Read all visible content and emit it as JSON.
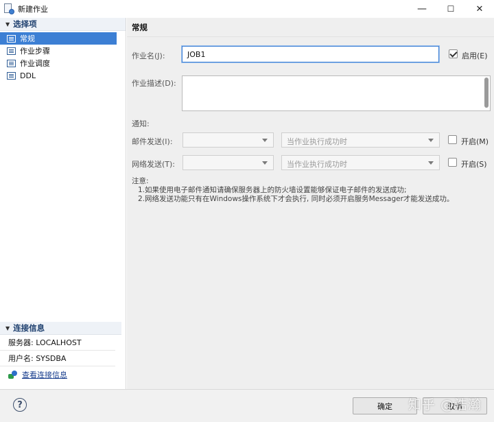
{
  "window": {
    "title": "新建作业",
    "minimize": "—",
    "maximize": "☐",
    "close": "✕"
  },
  "sidebar": {
    "section_title": "选择项",
    "items": [
      {
        "label": "常规"
      },
      {
        "label": "作业步骤"
      },
      {
        "label": "作业调度"
      },
      {
        "label": "DDL"
      }
    ],
    "selected_index": 0
  },
  "connection": {
    "section_title": "连接信息",
    "server": "服务器: LOCALHOST",
    "user": "用户名: SYSDBA",
    "view_link": "查看连接信息"
  },
  "main": {
    "header": "常规",
    "job_name_label": "作业名(J):",
    "job_name_value": "JOB1",
    "enable_label": "启用(E)",
    "enable_checked": true,
    "desc_label": "作业描述(D):",
    "desc_value": "",
    "notify_label": "通知:",
    "mail_label": "邮件发送(I):",
    "mail_condition_placeholder": "当作业执行成功时",
    "mail_open_label": "开启(M)",
    "net_label": "网络发送(T):",
    "net_condition_placeholder": "当作业执行成功时",
    "net_open_label": "开启(S)",
    "note_title": "注意:",
    "note_1": "1.如果使用电子邮件通知请确保服务器上的防火墙设置能够保证电子邮件的发送成功;",
    "note_2": "2.网络发送功能只有在Windows操作系统下才会执行, 同时必须开启服务Messager才能发送成功。"
  },
  "footer": {
    "help": "?",
    "ok": "确定",
    "cancel": "取消",
    "watermark": "知乎 @浩瀚"
  }
}
